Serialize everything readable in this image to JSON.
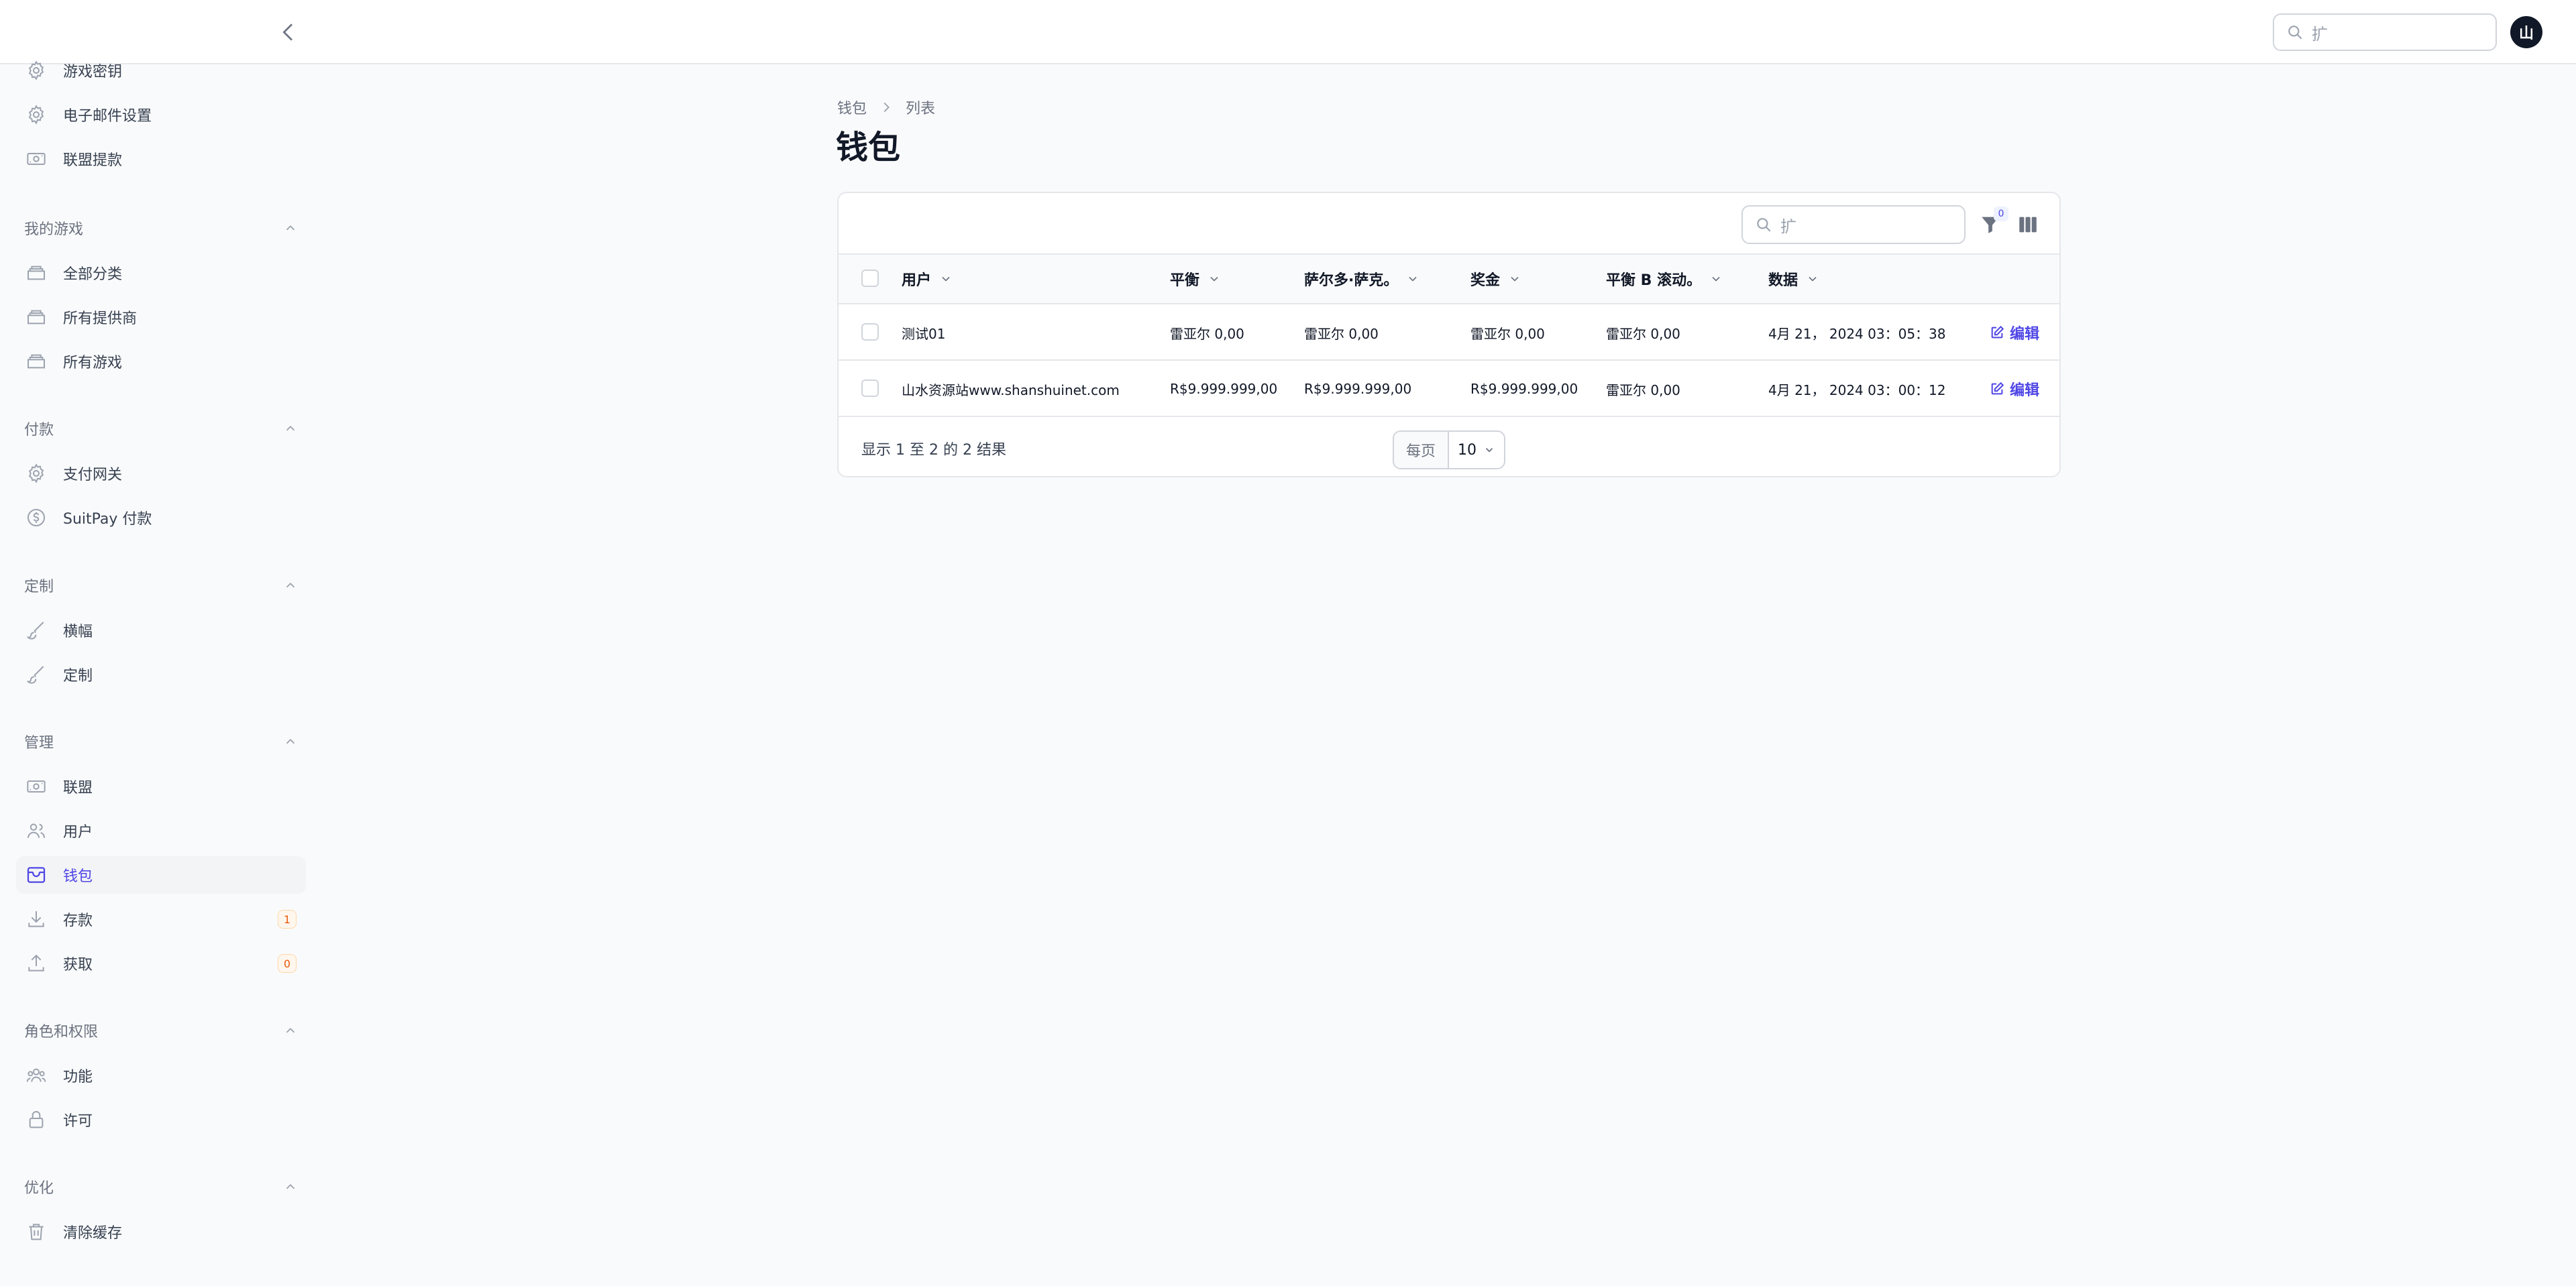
{
  "topbar": {
    "search_placeholder": "扩"
  },
  "avatar": {
    "initial": "山"
  },
  "sidebar": {
    "items_top": [
      {
        "label": "游戏密钥",
        "icon": "gear-icon"
      },
      {
        "label": "电子邮件设置",
        "icon": "gear-icon"
      },
      {
        "label": "联盟提款",
        "icon": "cash-icon"
      }
    ],
    "groups": [
      {
        "label": "我的游戏",
        "items": [
          {
            "label": "全部分类",
            "icon": "folder-icon"
          },
          {
            "label": "所有提供商",
            "icon": "folder-icon"
          },
          {
            "label": "所有游戏",
            "icon": "folder-icon"
          }
        ]
      },
      {
        "label": "付款",
        "items": [
          {
            "label": "支付网关",
            "icon": "gear-icon"
          },
          {
            "label": "SuitPay 付款",
            "icon": "dollar-icon"
          }
        ]
      },
      {
        "label": "定制",
        "items": [
          {
            "label": "横幅",
            "icon": "brush-icon"
          },
          {
            "label": "定制",
            "icon": "brush-icon"
          }
        ]
      },
      {
        "label": "管理",
        "items": [
          {
            "label": "联盟",
            "icon": "cash-icon"
          },
          {
            "label": "用户",
            "icon": "users-icon"
          },
          {
            "label": "钱包",
            "icon": "wallet-icon",
            "active": true
          },
          {
            "label": "存款",
            "icon": "download-icon",
            "badge": "1"
          },
          {
            "label": "获取",
            "icon": "upload-icon",
            "badge": "0"
          }
        ]
      },
      {
        "label": "角色和权限",
        "items": [
          {
            "label": "功能",
            "icon": "user-group-icon"
          },
          {
            "label": "许可",
            "icon": "lock-icon"
          }
        ]
      },
      {
        "label": "优化",
        "items": [
          {
            "label": "清除缓存",
            "icon": "trash-icon"
          }
        ]
      }
    ]
  },
  "breadcrumb": {
    "first": "钱包",
    "second": "列表"
  },
  "page_title": "钱包",
  "table": {
    "search_placeholder": "扩",
    "filter_count": "0",
    "columns": [
      "用户",
      "平衡",
      "萨尔多·萨克。",
      "奖金",
      "平衡 B 滚动。",
      "数据"
    ],
    "rows": [
      {
        "user": "测试01",
        "balance": "雷亚尔 0,00",
        "saldo": "雷亚尔 0,00",
        "bonus": "雷亚尔 0,00",
        "rollover": "雷亚尔 0,00",
        "date": "4月 21， 2024 03：05：38",
        "action": "编辑"
      },
      {
        "user": "山水资源站www.shanshuinet.com",
        "balance": "R$9.999.999,00",
        "saldo": "R$9.999.999,00",
        "bonus": "R$9.999.999,00",
        "rollover": "雷亚尔 0,00",
        "date": "4月 21， 2024 03：00：12",
        "action": "编辑"
      }
    ],
    "result_text": "显示 1 至 2 的 2 结果",
    "per_page_label": "每页",
    "per_page_value": "10"
  },
  "colors": {
    "accent": "#4f46e5",
    "badge": "#ea580c"
  }
}
